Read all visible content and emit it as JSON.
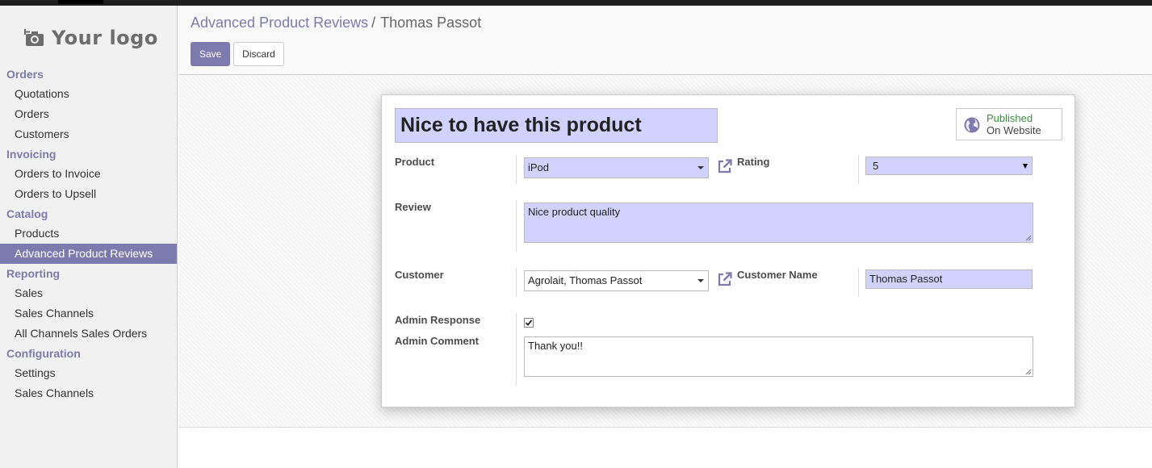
{
  "breadcrumb": {
    "parent": "Advanced Product Reviews",
    "separator": "/",
    "current": "Thomas Passot"
  },
  "toolbar": {
    "save_label": "Save",
    "discard_label": "Discard"
  },
  "logo": {
    "text": "Your logo",
    "icon": "camera-icon"
  },
  "sidebar": {
    "sections": [
      {
        "label": "Orders",
        "items": [
          "Quotations",
          "Orders",
          "Customers"
        ]
      },
      {
        "label": "Invoicing",
        "items": [
          "Orders to Invoice",
          "Orders to Upsell"
        ]
      },
      {
        "label": "Catalog",
        "items": [
          "Products",
          "Advanced Product Reviews"
        ]
      },
      {
        "label": "Reporting",
        "items": [
          "Sales",
          "Sales Channels",
          "All Channels Sales Orders"
        ]
      },
      {
        "label": "Configuration",
        "items": [
          "Settings",
          "Sales Channels"
        ]
      }
    ],
    "active_item": "Advanced Product Reviews"
  },
  "form": {
    "title": "Nice to have this product",
    "publish": {
      "line1": "Published",
      "line2": "On Website",
      "icon": "globe-icon"
    },
    "product": {
      "label": "Product",
      "value": "iPod"
    },
    "rating": {
      "label": "Rating",
      "value": "5"
    },
    "review": {
      "label": "Review",
      "value": "Nice product quality"
    },
    "customer": {
      "label": "Customer",
      "value": "Agrolait, Thomas Passot"
    },
    "customer_name": {
      "label": "Customer Name",
      "value": "Thomas Passot"
    },
    "admin_response": {
      "label": "Admin Response",
      "checked": true
    },
    "admin_comment": {
      "label": "Admin Comment",
      "value": "Thank you!!"
    }
  },
  "colors": {
    "accent": "#7c7bad",
    "required_field": "#d2d2ff",
    "published": "#3d8f3d"
  }
}
